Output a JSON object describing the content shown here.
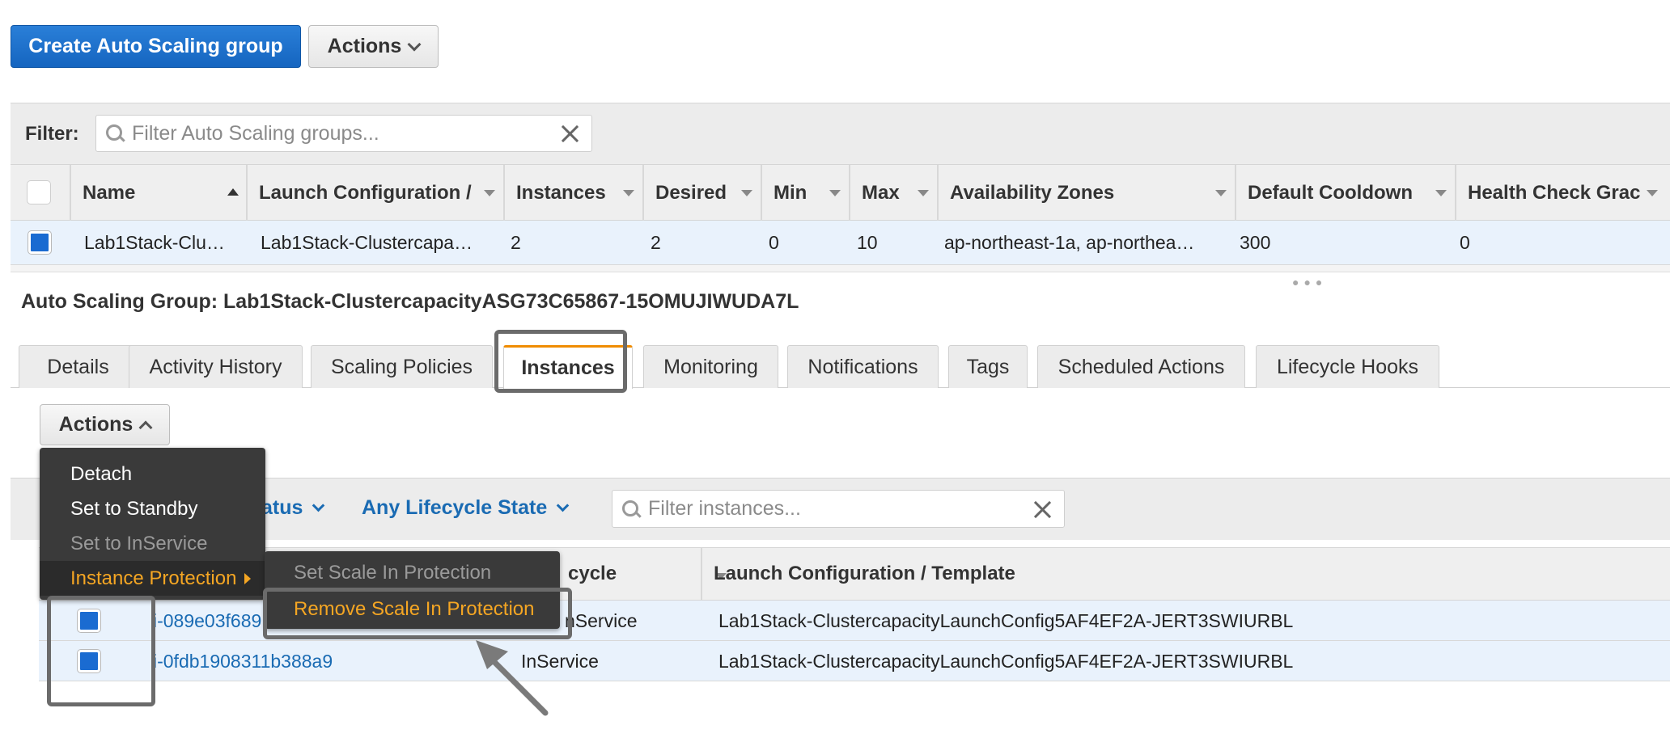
{
  "toolbar": {
    "create_label": "Create Auto Scaling group",
    "actions_label": "Actions"
  },
  "filter": {
    "label": "Filter:",
    "placeholder": "Filter Auto Scaling groups..."
  },
  "groups_table": {
    "columns": [
      "Name",
      "Launch Configuration /",
      "Instances",
      "Desired",
      "Min",
      "Max",
      "Availability Zones",
      "Default Cooldown",
      "Health Check Grac"
    ],
    "rows": [
      {
        "name": "Lab1Stack-Clu…",
        "launch_config": "Lab1Stack-Clustercapa…",
        "instances": "2",
        "desired": "2",
        "min": "0",
        "max": "10",
        "zones": "ap-northeast-1a, ap-northea…",
        "cooldown": "300",
        "health_grace": "0"
      }
    ]
  },
  "details": {
    "title_prefix": "Auto Scaling Group:",
    "group_name": "Lab1Stack-ClustercapacityASG73C65867-15OMUJIWUDA7L"
  },
  "tabs": [
    "Details",
    "Activity History",
    "Scaling Policies",
    "Instances",
    "Monitoring",
    "Notifications",
    "Tags",
    "Scheduled Actions",
    "Lifecycle Hooks"
  ],
  "active_tab": "Instances",
  "instances_panel": {
    "actions_label": "Actions",
    "health_filter_partial": "atus",
    "lifecycle_filter": "Any Lifecycle State",
    "search_placeholder": "Filter instances...",
    "columns": [
      "cycle",
      "Launch Configuration / Template"
    ],
    "rows": [
      {
        "id": "i-089e03f689",
        "lifecycle": "nService",
        "launch": "Lab1Stack-ClustercapacityLaunchConfig5AF4EF2A-JERT3SWIURBL"
      },
      {
        "id": "i-0fdb1908311b388a9",
        "lifecycle": "InService",
        "launch": "Lab1Stack-ClustercapacityLaunchConfig5AF4EF2A-JERT3SWIURBL"
      }
    ]
  },
  "actions_menu": {
    "items": [
      "Detach",
      "Set to Standby",
      "Set to InService",
      "Instance Protection"
    ],
    "submenu": [
      "Set Scale In Protection",
      "Remove Scale In Protection"
    ]
  },
  "colors": {
    "primary": "#1a6bd1",
    "link": "#1a6bb3",
    "menu_highlight": "#f5a623",
    "active_tab_accent": "#f08c00",
    "annotation_box": "#6b6b6b"
  }
}
